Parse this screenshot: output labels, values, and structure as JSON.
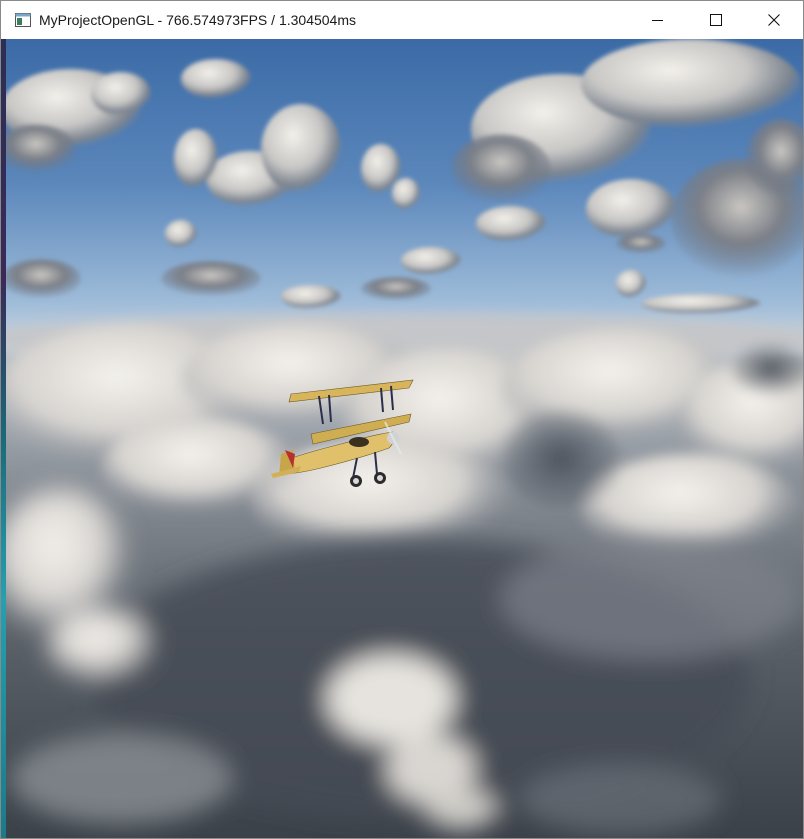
{
  "window": {
    "title": "MyProjectOpenGL - 766.574973FPS / 1.304504ms",
    "icon": "opengl-window-icon",
    "controls": {
      "minimize_icon": "minimize-icon",
      "maximize_icon": "maximize-icon",
      "close_icon": "close-icon"
    }
  },
  "scene": {
    "description_icon": "biplane-icon",
    "colors": {
      "sky_top": "#3d6fae",
      "sky_horizon": "#a9c3dd",
      "cloud_light": "#e8e6e2",
      "cloud_shadow": "#4a525e",
      "plane_body": "#d9b85a"
    }
  }
}
